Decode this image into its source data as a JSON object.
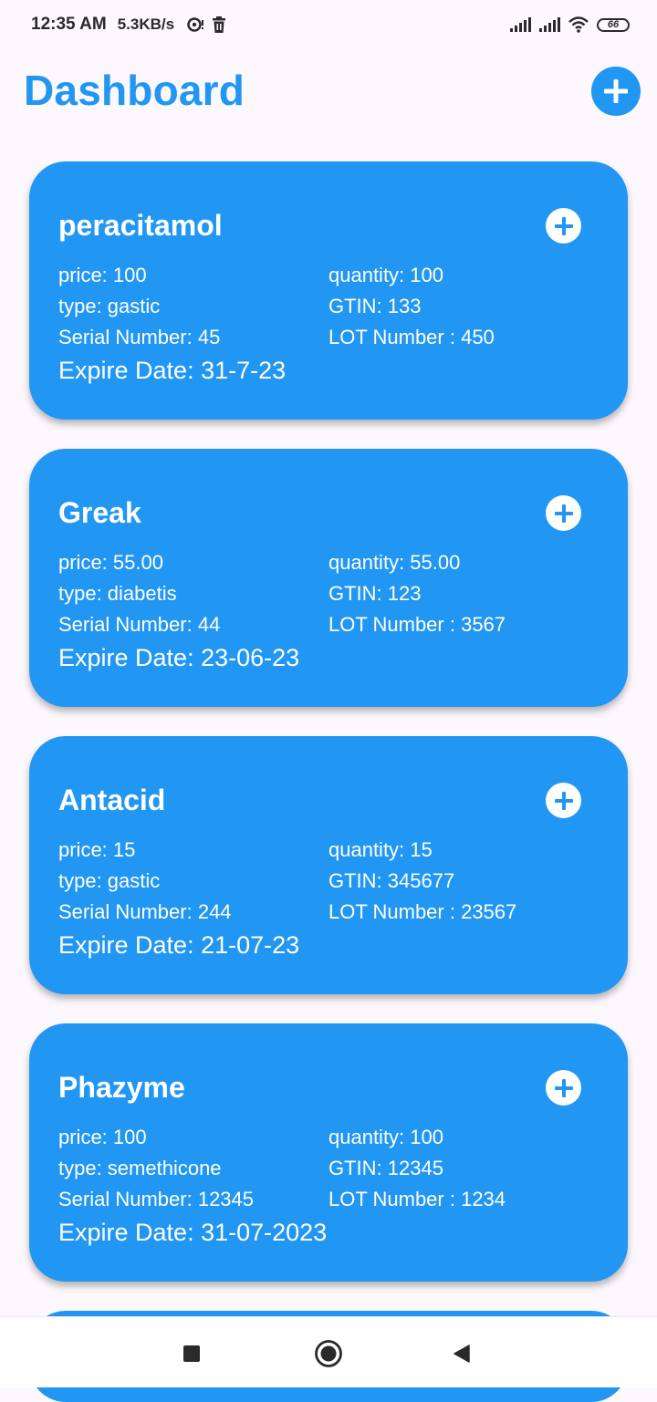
{
  "status_bar": {
    "time": "12:35 AM",
    "speed": "5.3KB/s",
    "battery": "66",
    "icons": [
      "data-saver-icon",
      "trash-icon",
      "signal-icon",
      "signal-icon",
      "wifi-icon",
      "battery-icon"
    ]
  },
  "header": {
    "title": "Dashboard",
    "add_icon": "plus-icon"
  },
  "accent_color": "#2196f3",
  "cards": [
    {
      "name": "peracitamol",
      "price": "price: 100",
      "quantity": "quantity: 100",
      "type": "type: gastic",
      "gtin": "GTIN: 133",
      "serial": "Serial Number: 45",
      "lot": "LOT Number : 450",
      "expire": "Expire Date: 31-7-23"
    },
    {
      "name": "Greak",
      "price": "price: 55.00",
      "quantity": "quantity: 55.00",
      "type": "type: diabetis",
      "gtin": "GTIN: 123",
      "serial": "Serial Number: 44",
      "lot": "LOT Number : 3567",
      "expire": "Expire Date: 23-06-23"
    },
    {
      "name": "Antacid",
      "price": "price: 15",
      "quantity": "quantity: 15",
      "type": "type: gastic",
      "gtin": "GTIN: 345677",
      "serial": "Serial Number: 244",
      "lot": "LOT Number : 23567",
      "expire": "Expire Date: 21-07-23"
    },
    {
      "name": "Phazyme",
      "price": "price: 100",
      "quantity": "quantity: 100",
      "type": "type: semethicone",
      "gtin": "GTIN: 12345",
      "serial": "Serial Number: 12345",
      "lot": "LOT Number : 1234",
      "expire": "Expire Date: 31-07-2023"
    }
  ],
  "nav": {
    "icons": [
      "recents-square-icon",
      "home-circle-icon",
      "back-triangle-icon"
    ]
  }
}
